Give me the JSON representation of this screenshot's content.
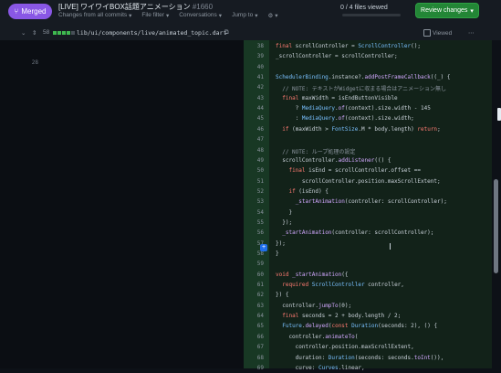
{
  "header": {
    "merged_label": "Merged",
    "title": "[LIVE] ワイワイBOX話題アニメーション",
    "pr_number": "#1660",
    "subnav": [
      "Changes from all commits",
      "File filter",
      "Conversations",
      "Jump to"
    ],
    "files_viewed": "0 / 4 files viewed",
    "files_viewed_progress": 0,
    "review_label": "Review changes"
  },
  "file": {
    "line_count": "58",
    "path": "lib/ui/components/live/animated_topic.dart",
    "viewed_label": "Viewed"
  },
  "left_rows": [
    {
      "ln": "",
      "code": ""
    },
    {
      "ln": "28",
      "code": ""
    }
  ],
  "right_rows": [
    {
      "n": "38",
      "code": "final scrollController = ScrollController();"
    },
    {
      "n": "39",
      "code": "_scrollController = scrollController;"
    },
    {
      "n": "40",
      "code": ""
    },
    {
      "n": "41",
      "code": "SchedulerBinding.instance?.addPostFrameCallback((_) {"
    },
    {
      "n": "42",
      "code": "  // NOTE: テキストがWidgetに収まる場合はアニメーション無し"
    },
    {
      "n": "43",
      "code": "  final maxWidth = isEndButtonVisible"
    },
    {
      "n": "44",
      "code": "      ? MediaQuery.of(context).size.width - 145"
    },
    {
      "n": "45",
      "code": "      : MediaQuery.of(context).size.width;"
    },
    {
      "n": "46",
      "code": "  if (maxWidth > FontSize.M * body.length) return;"
    },
    {
      "n": "47",
      "code": ""
    },
    {
      "n": "48",
      "code": "  // NOTE: ループ処理の設定"
    },
    {
      "n": "49",
      "code": "  scrollController.addListener(() {"
    },
    {
      "n": "50",
      "code": "    final isEnd = scrollController.offset =="
    },
    {
      "n": "51",
      "code": "        scrollController.position.maxScrollExtent;"
    },
    {
      "n": "52",
      "code": "    if (isEnd) {"
    },
    {
      "n": "53",
      "code": "      _startAnimation(controller: scrollController);"
    },
    {
      "n": "54",
      "code": "    }"
    },
    {
      "n": "55",
      "code": "  });"
    },
    {
      "n": "56",
      "code": "  _startAnimation(controller: scrollController);"
    },
    {
      "n": "57",
      "code": "});"
    },
    {
      "n": "58",
      "code": "}"
    },
    {
      "n": "59",
      "code": ""
    },
    {
      "n": "60",
      "code": "void _startAnimation({"
    },
    {
      "n": "61",
      "code": "  required ScrollController controller,"
    },
    {
      "n": "62",
      "code": "}) {"
    },
    {
      "n": "63",
      "code": "  controller.jumpTo(0);"
    },
    {
      "n": "64",
      "code": "  final seconds = 2 + body.length / 2;"
    },
    {
      "n": "65",
      "code": "  Future.delayed(const Duration(seconds: 2), () {"
    },
    {
      "n": "66",
      "code": "    controller.animateTo("
    },
    {
      "n": "67",
      "code": "      controller.position.maxScrollExtent,"
    },
    {
      "n": "68",
      "code": "      duration: Duration(seconds: seconds.toInt()),"
    },
    {
      "n": "69",
      "code": "      curve: Curves.linear,"
    }
  ]
}
